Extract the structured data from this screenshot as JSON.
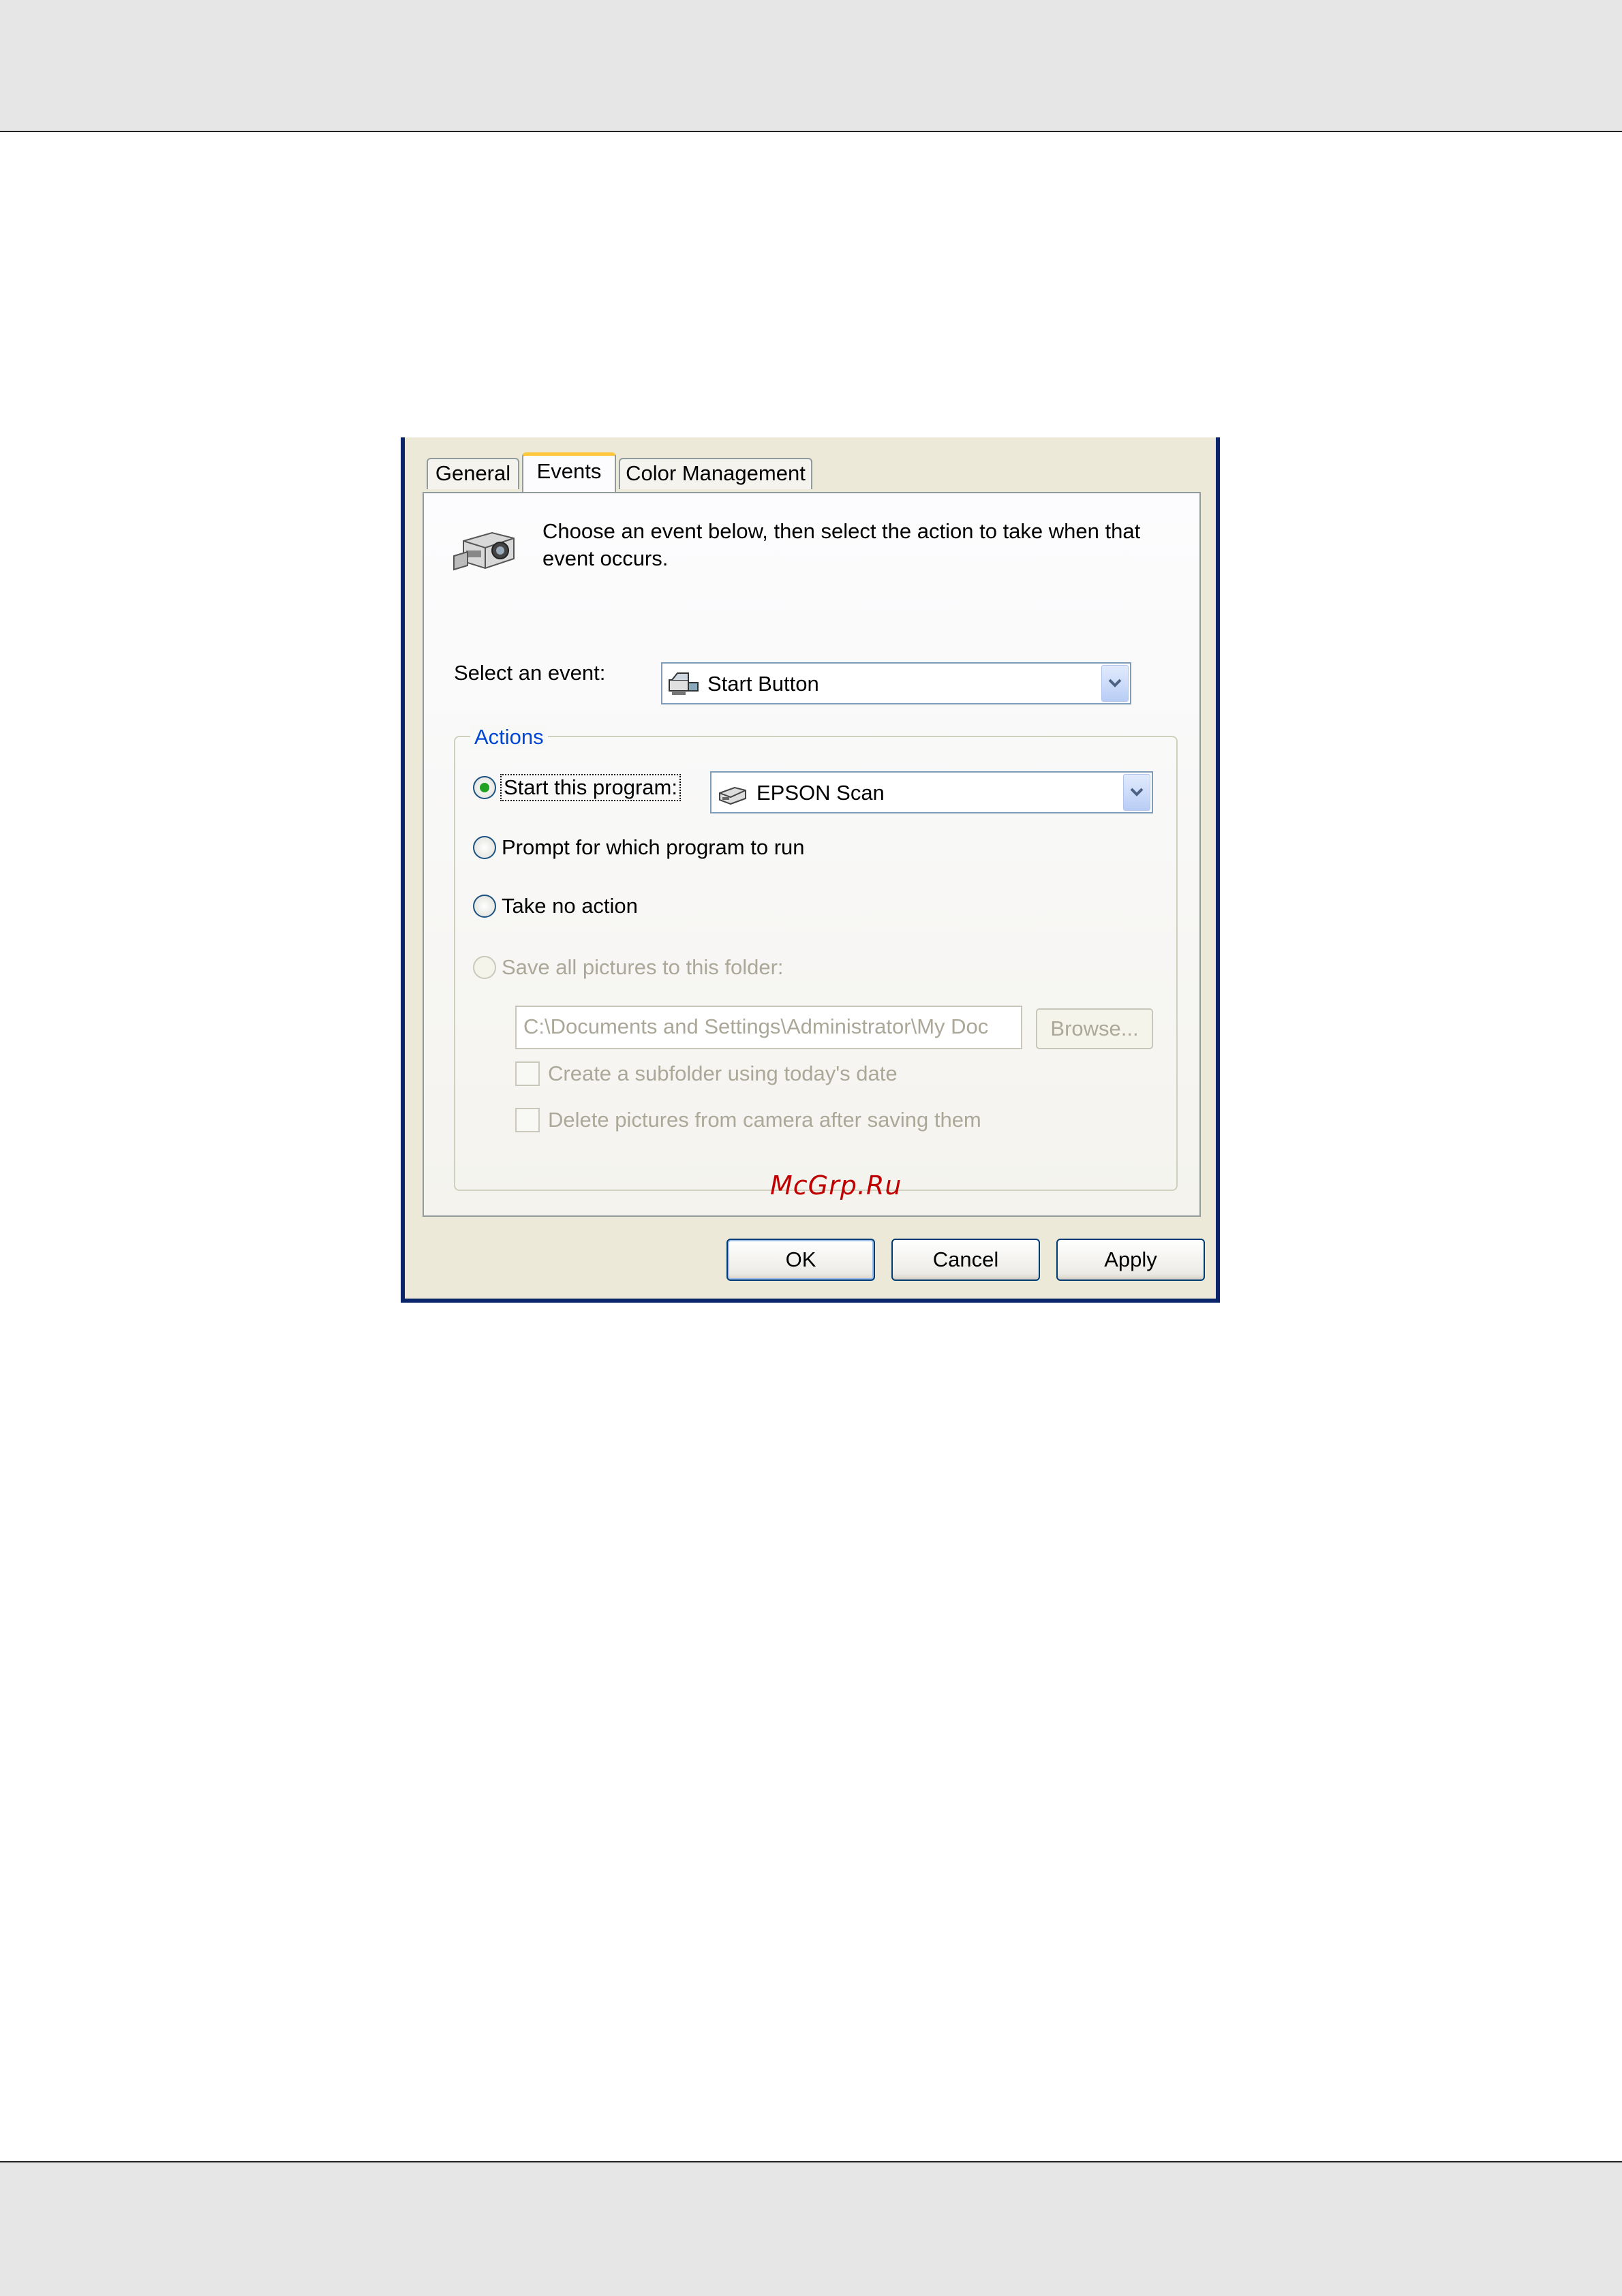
{
  "tabs": [
    {
      "label": "General"
    },
    {
      "label": "Events"
    },
    {
      "label": "Color Management"
    }
  ],
  "active_tab": "Events",
  "intro_text": "Choose an event below, then select the action to take when that event occurs.",
  "event": {
    "label": "Select an event:",
    "selected": "Start Button",
    "icon": "start-button-event-icon"
  },
  "actions": {
    "legend": "Actions",
    "start_program_label": "Start this program:",
    "program_selected": "EPSON Scan",
    "program_icon": "scanner-icon",
    "prompt_label": "Prompt for which program to run",
    "no_action_label": "Take no action",
    "save_pictures_label": "Save all pictures to this folder:",
    "folder_path": "C:\\Documents and Settings\\Administrator\\My Doc",
    "browse_label": "Browse...",
    "subfolder_label": "Create a subfolder using today's date",
    "delete_label": "Delete pictures from camera after saving them",
    "selected_option": "Start this program:"
  },
  "watermark": "McGrp.Ru",
  "buttons": {
    "ok": "OK",
    "cancel": "Cancel",
    "apply": "Apply"
  },
  "colors": {
    "dialog_bg": "#ece9d8",
    "frame": "#0a246a",
    "legend": "#0046d5",
    "active_tab_accent": "#ffc83c",
    "radio_dot": "#21a121",
    "disabled_text": "#aca899"
  }
}
